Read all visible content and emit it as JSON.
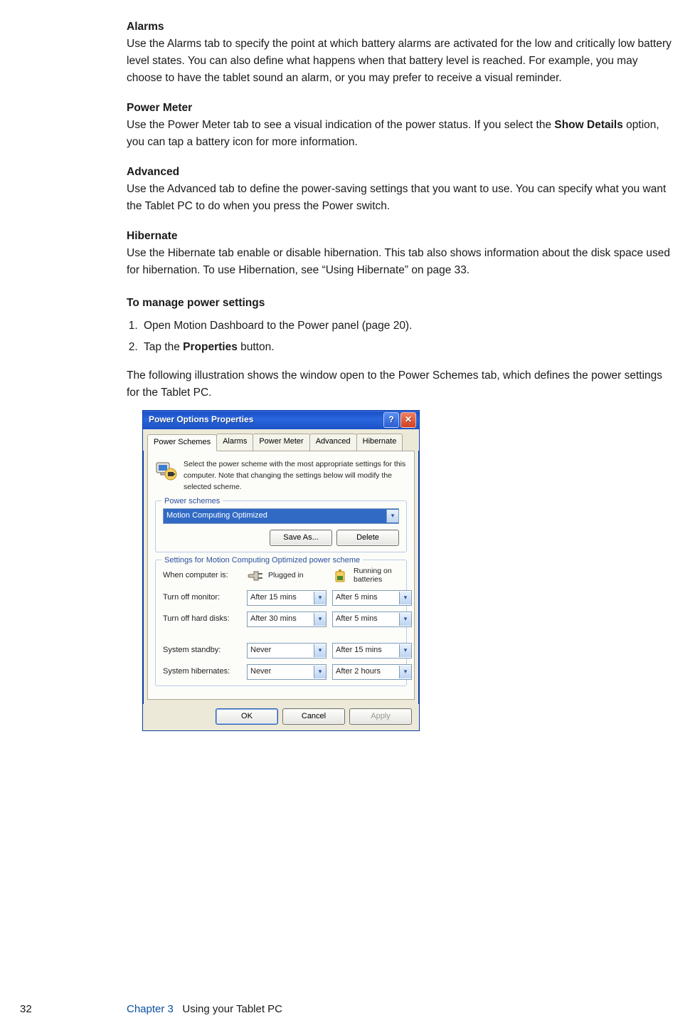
{
  "sections": {
    "alarms": {
      "head": "Alarms",
      "body": "Use the Alarms tab to specify the point at which battery alarms are activated for the low and critically low battery level states. You can also define what happens when that battery level is reached. For example, you may choose to have the tablet sound an alarm, or you may prefer to receive a visual reminder."
    },
    "power_meter": {
      "head": "Power Meter",
      "body_pre": "Use the Power Meter tab to see a visual indication of the power status. If you select the ",
      "body_bold": "Show Details",
      "body_post": " option, you can tap a battery icon for more information."
    },
    "advanced": {
      "head": "Advanced",
      "body": "Use the Advanced tab to define the power-saving settings that you want to use. You can specify what you want the Tablet PC to do when you press the Power switch."
    },
    "hibernate": {
      "head": "Hibernate",
      "body": "Use the Hibernate tab enable or disable hibernation. This tab also shows information about the disk space used for hibernation. To use Hibernation, see “Using Hibernate” on page 33."
    },
    "manage": {
      "head": "To manage power settings",
      "step1": "Open Motion Dashboard to the Power panel (page 20).",
      "step2_pre": "Tap the ",
      "step2_bold": "Properties",
      "step2_post": " button."
    },
    "illus_intro": "The following illustration shows the window open to the Power Schemes tab, which defines the power settings for the Tablet PC."
  },
  "dialog": {
    "title": "Power Options Properties",
    "help": "?",
    "close": "✕",
    "tabs": [
      "Power Schemes",
      "Alarms",
      "Power Meter",
      "Advanced",
      "Hibernate"
    ],
    "intro": "Select the power scheme with the most appropriate settings for this computer. Note that changing the settings below will modify the selected scheme.",
    "group1_legend": "Power schemes",
    "scheme_value": "Motion Computing Optimized",
    "save_as": "Save As...",
    "delete": "Delete",
    "group2_legend": "Settings for Motion Computing Optimized power scheme",
    "col_label": "When computer is:",
    "col_plugged": "Plugged in",
    "col_battery": "Running on batteries",
    "rows": {
      "monitor": {
        "label": "Turn off monitor:",
        "plugged": "After 15 mins",
        "battery": "After 5 mins"
      },
      "hdd": {
        "label": "Turn off hard disks:",
        "plugged": "After 30 mins",
        "battery": "After 5 mins"
      },
      "standby": {
        "label": "System standby:",
        "plugged": "Never",
        "battery": "After 15 mins"
      },
      "hibernate": {
        "label": "System hibernates:",
        "plugged": "Never",
        "battery": "After 2 hours"
      }
    },
    "ok": "OK",
    "cancel": "Cancel",
    "apply": "Apply"
  },
  "footer": {
    "page": "32",
    "chapter": "Chapter 3",
    "title": "Using your Tablet PC"
  }
}
